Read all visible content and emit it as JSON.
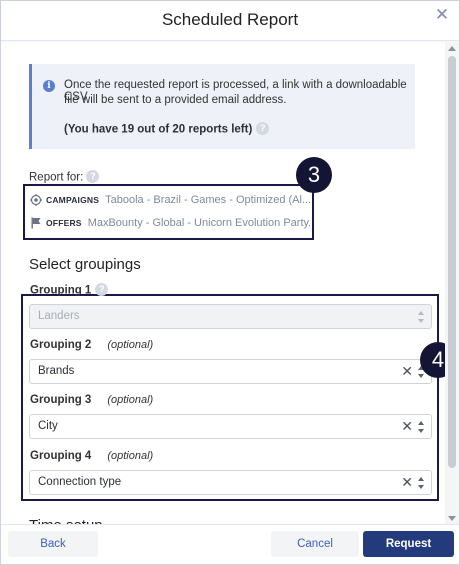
{
  "modal": {
    "title": "Scheduled Report",
    "close_icon": "close-icon"
  },
  "info": {
    "line1": "Once the requested report is processed, a link with a downloadable CSV",
    "line2": "file will be sent to a provided email address.",
    "quota": "(You have 19 out of 20 reports left)"
  },
  "report_for": {
    "label": "Report for:",
    "campaigns": {
      "label": "CAMPAIGNS",
      "value": "Taboola - Brazil - Games - Optimized (Al..."
    },
    "offers": {
      "label": "OFFERS",
      "value": "MaxBounty - Global - Unicorn Evolution Party..."
    }
  },
  "groupings": {
    "title": "Select groupings",
    "items": [
      {
        "label": "Grouping 1",
        "optional": "",
        "value": "Landers",
        "disabled": true
      },
      {
        "label": "Grouping 2",
        "optional": "(optional)",
        "value": "Brands"
      },
      {
        "label": "Grouping 3",
        "optional": "(optional)",
        "value": "City"
      },
      {
        "label": "Grouping 4",
        "optional": "(optional)",
        "value": "Connection type"
      }
    ]
  },
  "time_setup": {
    "title": "Time setup"
  },
  "annotations": {
    "badge3": "3",
    "badge4": "4",
    "color": "#141434"
  },
  "footer": {
    "back": "Back",
    "cancel": "Cancel",
    "request": "Request",
    "accent": "#233a7d"
  }
}
